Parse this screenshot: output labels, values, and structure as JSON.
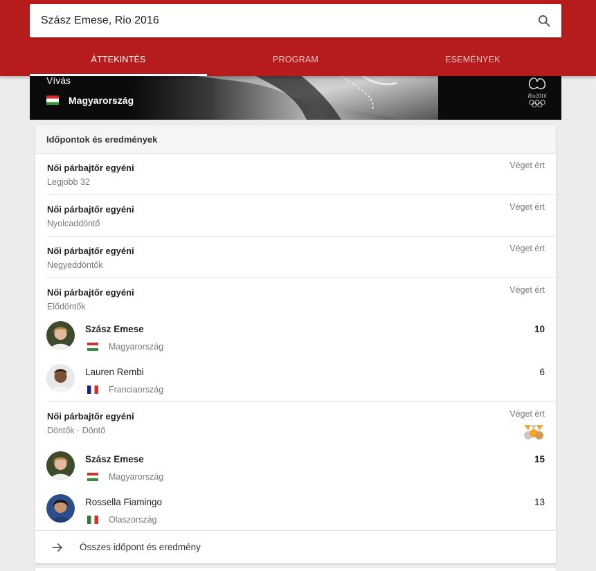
{
  "search": {
    "value": "Szász Emese, Rio 2016"
  },
  "tabs": [
    {
      "label": "Áttekintés",
      "active": true
    },
    {
      "label": "Program",
      "active": false
    },
    {
      "label": "Események",
      "active": false
    }
  ],
  "hero": {
    "sport": "Vívás",
    "country": "Magyarország",
    "logo_text": "Rio2016"
  },
  "card": {
    "title": "Időpontok és eredmények",
    "events": [
      {
        "title": "Női párbajtőr egyéni",
        "round": "Legjobb 32",
        "status": "Véget ért"
      },
      {
        "title": "Női párbajtőr egyéni",
        "round": "Nyolcaddöntő",
        "status": "Véget ért"
      },
      {
        "title": "Női párbajtőr egyéni",
        "round": "Negyeddöntők",
        "status": "Véget ért"
      },
      {
        "title": "Női párbajtőr egyéni",
        "round": "Elődöntők",
        "status": "Véget ért",
        "players": [
          {
            "name": "Szász Emese",
            "country": "Magyarország",
            "score": "10",
            "winner": true
          },
          {
            "name": "Lauren Rembi",
            "country": "Franciaország",
            "score": "6",
            "winner": false
          }
        ]
      },
      {
        "title": "Női párbajtőr egyéni",
        "round": "Döntők · Döntő",
        "status": "Véget ért",
        "players": [
          {
            "name": "Szász Emese",
            "country": "Magyarország",
            "score": "15",
            "winner": true
          },
          {
            "name": "Rossella Fiamingo",
            "country": "Olaszország",
            "score": "13",
            "winner": false
          }
        ]
      }
    ],
    "footer_link": "Összes időpont és eredmény"
  },
  "colors": {
    "brand_red": "#b71c1c",
    "muted_text": "#777777"
  },
  "icons": {
    "search": "search-icon",
    "footer": "arrow-right-icon",
    "medals": "medals-icon"
  }
}
